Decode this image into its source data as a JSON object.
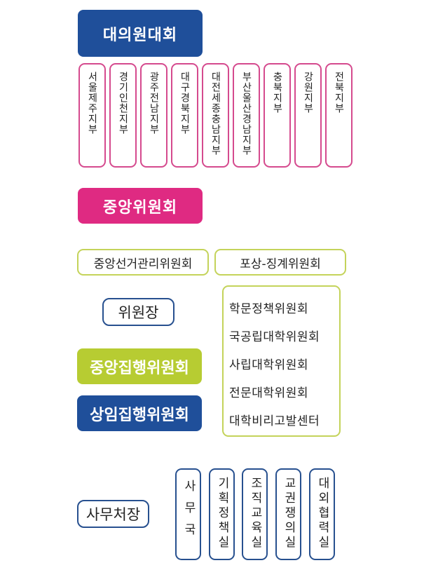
{
  "delegates": {
    "label": "대의원대회"
  },
  "branches": [
    "서울제주지부",
    "경기인천지부",
    "광주전남지부",
    "대구경북지부",
    "대전세종충남지부",
    "부산울산경남지부",
    "충북지부",
    "강원지부",
    "전북지부"
  ],
  "central_committee": {
    "label": "중앙위원회"
  },
  "election_committee": {
    "label": "중앙선거관리위원회"
  },
  "discipline_committee": {
    "label": "포상-징계위원회"
  },
  "chairman": {
    "label": "위원장"
  },
  "central_executive": {
    "label": "중앙집행위원회"
  },
  "standing_executive": {
    "label": "상임집행위원회"
  },
  "sub_committees": [
    "학문정책위원회",
    "국공립대학위원회",
    "사립대학위원회",
    "전문대학위원회",
    "대학비리고발센터"
  ],
  "secretary_general": {
    "label": "사무처장"
  },
  "offices": [
    "사무국",
    "기획정책실",
    "조직교육실",
    "교권쟁의실",
    "대외협력실"
  ],
  "colors": {
    "blue": "#1f4f9a",
    "pink": "#df2a82",
    "green": "#b7cc32"
  }
}
